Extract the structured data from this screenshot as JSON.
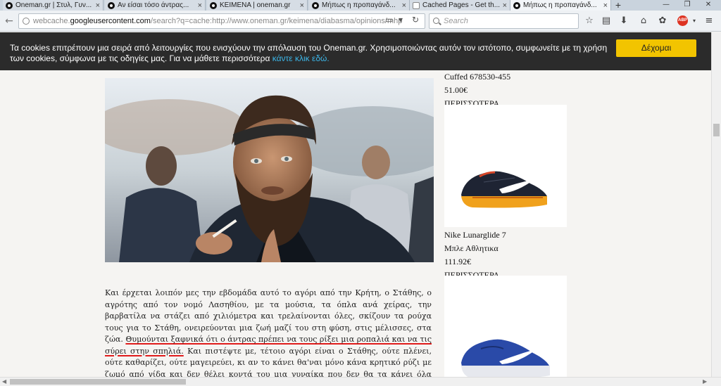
{
  "browser": {
    "tabs": [
      {
        "title": "Oneman.gr | Στυλ, Γυν...",
        "icon": "oneman-icon",
        "active": false
      },
      {
        "title": "Αν είσαι τόσο άντρας...",
        "icon": "oneman-icon",
        "active": false
      },
      {
        "title": "ΚΕΙΜΕΝΑ | oneman.gr",
        "icon": "oneman-icon",
        "active": false
      },
      {
        "title": "Μήπως η προπαγάνδ...",
        "icon": "oneman-icon",
        "active": false
      },
      {
        "title": "Cached Pages - Get th...",
        "icon": "cache-page-icon",
        "active": false
      },
      {
        "title": "Μήπως η προπαγάνδ...",
        "icon": "oneman-icon",
        "active": true
      }
    ],
    "url_prefix": "webcache.",
    "url_domain": "googleusercontent.com",
    "url_rest": "/search?q=cache:http://www.oneman.gr/keimena/diabasma/opinions/mhp",
    "search_placeholder": "Search"
  },
  "cookie_banner": {
    "message": "Τα cookies επιτρέπουν μια σειρά από λειτουργίες που ενισχύουν την απόλαυση του Oneman.gr. Χρησιμοποιώντας αυτόν τον ιστότοπο, συμφωνείτε με τη χρήση των cookies, σύμφωνα με τις οδηγίες μας. Για να μάθετε περισσότερα",
    "link": "κάντε κλικ εδώ.",
    "accept_label": "Δέχομαι"
  },
  "article": {
    "paragraph_start": "Και έρχεται λοιπόν μες την εβδομάδα αυτό το αγόρι από την Κρήτη, ο Στάθης, ο αγρότης από τον νομό Λασηθίου, με τα μούσια, τα όπλα ανά χείρας, την βαρβατίλα να στάζει από χιλιόμετρα και τρελαίνονται όλες, σκίζουν τα ρούχα τους για το Στάθη, ονειρεύονται μια ζωή μαζί του στη φύση, στις μέλισσες, στα ζώα. ",
    "highlighted": "Θυμούνται ξαφνικά ότι ο άντρας πρέπει να τους ρίξει μια ροπαλιά και να τις σύρει στην σπηλιά.",
    "paragraph_end": " Και πιστέψτε με, τέτοιο αγόρι είναι ο Στάθης, ούτε πλένει, ούτε καθαρίζει, ούτε μαγειρεύει, κι αν το κάνει θα'ναι μόνο κάνα κρητικό ρύζι με ζωμό από γίδα και δεν θέλει κοντά του μια γυναίκα που δεν θα τα κάνει όλα αυτά. Παρόλα αυτά ο Στάθης είναι σέξι και όλες έχουν πάθει την πλάκα τους"
  },
  "sidebar": {
    "product1": {
      "name": "Cuffed 678530-455",
      "price": "51.00€",
      "more": "ΠΕΡΙΣΣΟΤΕΡΑ"
    },
    "product2": {
      "name": "Nike Lunarglide 7",
      "subtitle": "Μπλε Αθλητικα",
      "price": "111.92€",
      "more": "ΠΕΡΙΣΣΟΤΕΡΑ"
    }
  },
  "colors": {
    "banner_bg": "#2b2b2b",
    "accept_button": "#f2c400",
    "link": "#3cb6e8",
    "underline_annotation": "#e01b1b"
  }
}
